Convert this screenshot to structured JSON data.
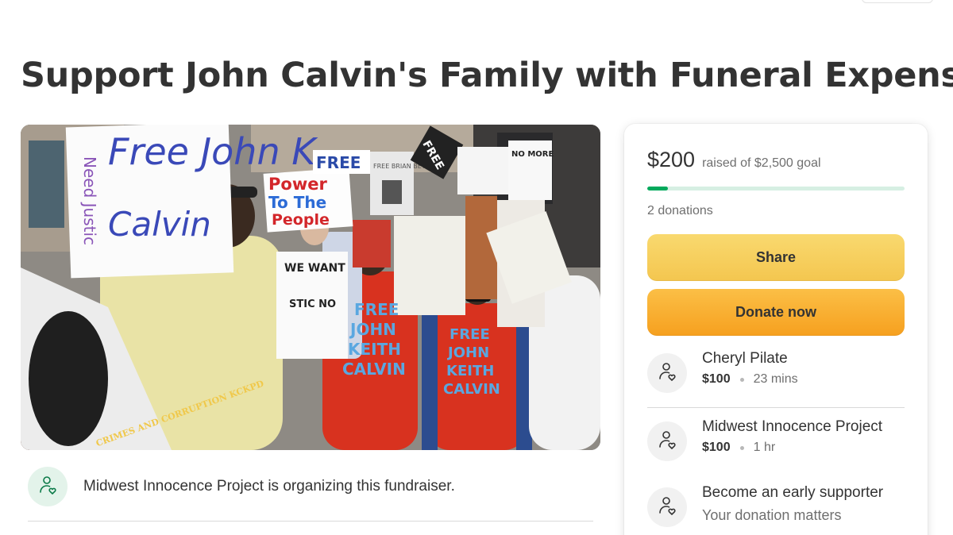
{
  "page": {
    "title": "Support John Calvin's Family with Funeral Expense"
  },
  "hero": {
    "signs": {
      "free_johnk": "Free John K.",
      "calvin": "Calvin",
      "need_justice": "Need Justic",
      "power": "Power",
      "to_the": "To The",
      "people": "People",
      "free_blue": "FREE",
      "free_brian": "FREE BRIAN BETTS",
      "free_black": "FREE",
      "no_more": "NO MORE",
      "we_want": "WE WANT",
      "justice_no": "STIC NO",
      "crimes": "CRIMES AND CORRUPTION KCKPD",
      "shirt1_line1": "FREE",
      "shirt1_line2": "JOHN",
      "shirt1_line3": "KEITH",
      "shirt1_line4": "CALVIN",
      "shirt2_line1": "FREE",
      "shirt2_line2": "JOHN",
      "shirt2_line3": "KEITH",
      "shirt2_line4": "CALVIN"
    }
  },
  "organizer": {
    "text": "Midwest Innocence Project is organizing this fundraiser.",
    "icon": "person-heart-icon"
  },
  "donation": {
    "raised": "$200",
    "goal_text": "raised of $2,500 goal",
    "progress_fraction": 0.08,
    "count_text": "2 donations",
    "share_label": "Share",
    "donate_label": "Donate now",
    "donors": [
      {
        "name": "Cheryl Pilate",
        "amount": "$100",
        "time": "23 mins",
        "icon": "person-heart-icon"
      },
      {
        "name": "Midwest Innocence Project",
        "amount": "$100",
        "time": "1 hr",
        "icon": "person-heart-icon"
      }
    ],
    "early": {
      "title": "Become an early supporter",
      "subtitle": "Your donation matters",
      "icon": "person-heart-icon"
    }
  },
  "colors": {
    "accent_green": "#02a95c",
    "share_yellow": "#f6cc5a",
    "donate_orange": "#f8ab2e",
    "text": "#333333"
  }
}
